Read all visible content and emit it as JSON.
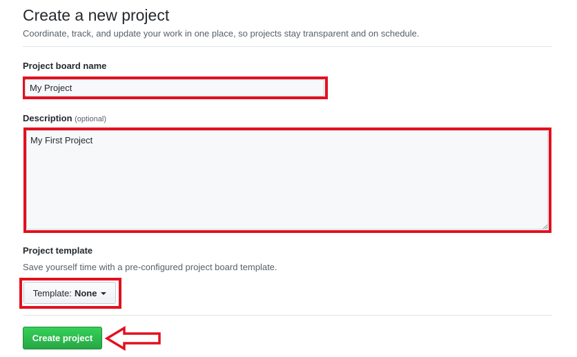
{
  "header": {
    "title": "Create a new project",
    "subtitle": "Coordinate, track, and update your work in one place, so projects stay transparent and on schedule."
  },
  "form": {
    "name_label": "Project board name",
    "name_value": "My Project",
    "description_label": "Description",
    "description_optional": "(optional)",
    "description_value": "My First Project",
    "template_label": "Project template",
    "template_hint": "Save yourself time with a pre-configured project board template.",
    "template_button_prefix": "Template:",
    "template_button_value": "None",
    "submit_label": "Create project"
  },
  "icons": {
    "template_caret": "caret-down-icon",
    "resize_grip": "resize-grip-icon",
    "annotation_arrow": "left-arrow-icon"
  },
  "colors": {
    "annotation_red": "#e3101f",
    "primary_green": "#28a745",
    "text": "#24292e",
    "muted_text": "#586069"
  }
}
